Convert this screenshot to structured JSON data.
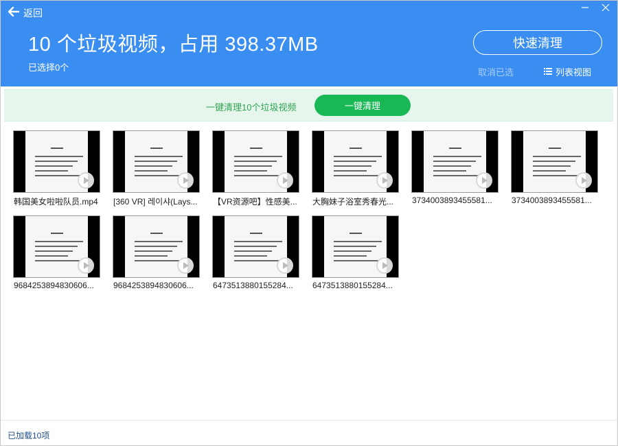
{
  "header": {
    "back_label": "返回",
    "title": "10 个垃圾视频，占用 398.37MB",
    "selected_text": "已选择0个",
    "quick_clean_label": "快速清理",
    "cancel_selection_label": "取消已选",
    "list_view_label": "列表视图"
  },
  "banner": {
    "text": "一键清理10个垃圾视频",
    "button_label": "一键清理"
  },
  "videos": [
    {
      "name": "韩国美女啦啦队员.mp4"
    },
    {
      "name": "[360 VR] 레이샤(Lays..."
    },
    {
      "name": "【VR资源吧】性感美..."
    },
    {
      "name": "大胸妹子浴室秀春光..."
    },
    {
      "name": "3734003893455581..."
    },
    {
      "name": "3734003893455581..."
    },
    {
      "name": "9684253894830606..."
    },
    {
      "name": "9684253894830606..."
    },
    {
      "name": "6473513880155284..."
    },
    {
      "name": "6473513880155284..."
    }
  ],
  "footer": {
    "status": "已加载10项"
  },
  "colors": {
    "header_bg": "#3a8df1",
    "banner_bg": "#e7f6ec",
    "accent_green": "#18b955",
    "banner_text": "#2ea352"
  },
  "icons": {
    "back": "arrow-left-icon",
    "minimize": "minimize-icon",
    "close": "close-icon",
    "list_view": "list-icon",
    "play": "play-icon"
  }
}
